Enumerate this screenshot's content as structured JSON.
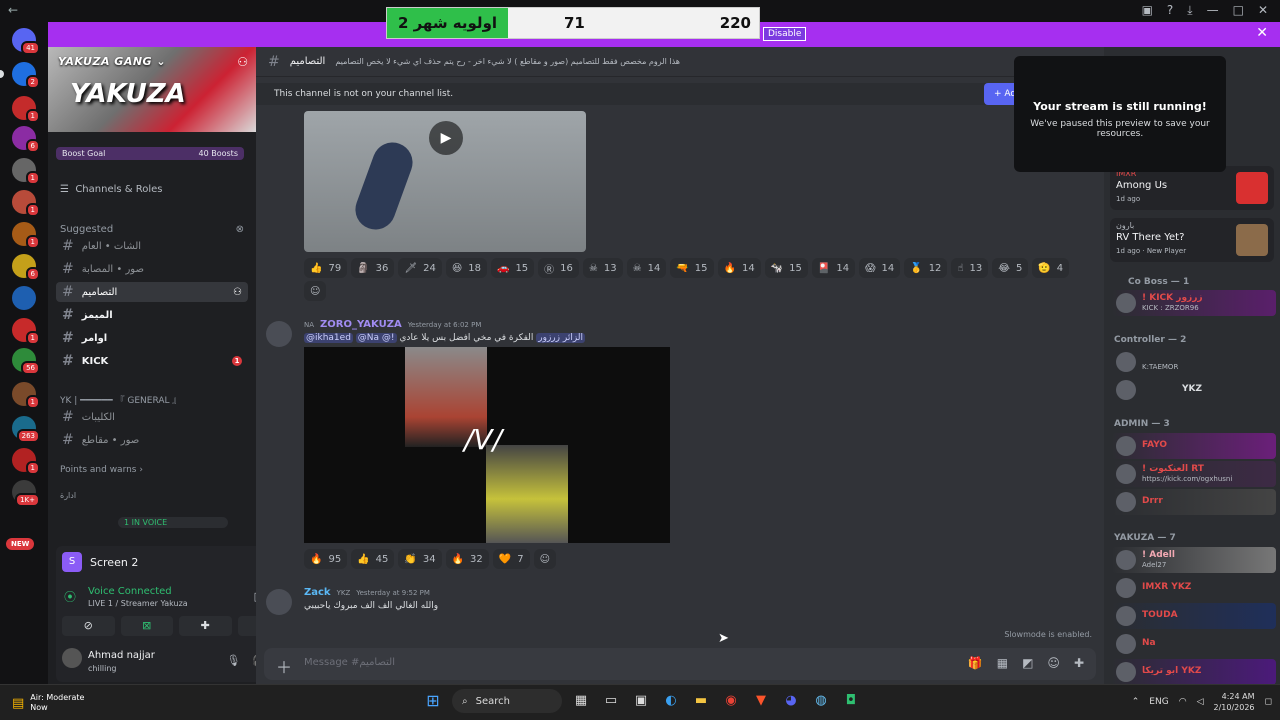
{
  "counter": {
    "title": "اولويه شهر 2",
    "middle": "71",
    "right": "220",
    "disable_label": "Disable"
  },
  "server": {
    "name": "YAKUZA GANG",
    "logo_text": "YAKUZA",
    "boost_goal": "Boost Goal",
    "boost_count": "40 Boosts"
  },
  "rail": {
    "new_label": "NEW",
    "badges": [
      "41",
      "2",
      "1",
      "6",
      "1",
      "1",
      "1",
      "6",
      "1",
      "1",
      "1",
      "56",
      "1",
      "263",
      "1",
      "1K+",
      "1"
    ]
  },
  "sidebar": {
    "channels_roles": "Channels & Roles",
    "suggested_label": "Suggested",
    "suggested": [
      {
        "name": "الشات • العام",
        "active": false,
        "bright": false
      },
      {
        "name": "صور • المصابة",
        "active": false,
        "bright": false
      },
      {
        "name": "التصاميم",
        "active": true,
        "bright": false
      },
      {
        "name": "الميمز",
        "active": false,
        "bright": true
      },
      {
        "name": "اوامر",
        "active": false,
        "bright": true
      },
      {
        "name": "KICK",
        "active": false,
        "bright": true,
        "badge": "1"
      }
    ],
    "general_header": "YK | ━━━━━━ 『 GENERAL 』",
    "general": [
      {
        "name": "الكليبات"
      },
      {
        "name": "صور • مقاطع"
      }
    ],
    "points_warns": "Points and warns",
    "admin_header": "ادارة",
    "in_voice": "1 IN VOICE"
  },
  "voice": {
    "screen_title": "Screen 2",
    "connected": "Voice Connected",
    "live_label": "LIVE 1 / Streamer Yakuza"
  },
  "user": {
    "name": "Ahmad najjar",
    "status": "chilling"
  },
  "channel": {
    "name": "التصاميم",
    "topic": "هذا الروم مخصص فقط للتصاميم (صور و مقاطع ) لا شيء اخر - رح يتم حذف اي شيء لا يخص التصاميم",
    "notice": "This channel is not on your channel list.",
    "notice_button": "+ Add"
  },
  "stream_popup": {
    "title": "Your stream is still running!",
    "subtitle": "We've paused this preview to save your resources."
  },
  "reactions1": [
    {
      "e": "👍",
      "n": "79"
    },
    {
      "e": "🗿",
      "n": "36"
    },
    {
      "e": "🗡",
      "n": "24"
    },
    {
      "e": "😆",
      "n": "18"
    },
    {
      "e": "🚗",
      "n": "15"
    },
    {
      "e": "Ⓡ",
      "n": "16"
    },
    {
      "e": "☠",
      "n": "13"
    },
    {
      "e": "☠",
      "n": "14"
    },
    {
      "e": "🔫",
      "n": "15"
    },
    {
      "e": "🔥",
      "n": "14"
    },
    {
      "e": "🐄",
      "n": "15"
    },
    {
      "e": "🎴",
      "n": "14"
    },
    {
      "e": "😱",
      "n": "14"
    },
    {
      "e": "🥇",
      "n": "12"
    },
    {
      "e": "☝",
      "n": "13"
    },
    {
      "e": "😂",
      "n": "5"
    },
    {
      "e": "🫡",
      "n": "4"
    }
  ],
  "messages": [
    {
      "author": "ZORO_YAKUZA",
      "tag": "NA",
      "time": "Yesterday at 6:02 PM",
      "mentions": [
        "@ikha1ed",
        "@Na @!"
      ],
      "mention_extra": "الزائر زرزور",
      "text": "الفكرة في مخي افضل بس يلا عادي"
    },
    {
      "author": "Zack",
      "tag": "YKZ",
      "time": "Yesterday at 9:52 PM",
      "text": "والله الغالي الف الف مبروك ياحبيبي"
    }
  ],
  "reactions2": [
    {
      "e": "🔥",
      "n": "95"
    },
    {
      "e": "👍",
      "n": "45"
    },
    {
      "e": "👏",
      "n": "34"
    },
    {
      "e": "🔥",
      "n": "32"
    },
    {
      "e": "🧡",
      "n": "7"
    }
  ],
  "composer": {
    "placeholder": "Message #التصاميم",
    "slowmode": "Slowmode is enabled."
  },
  "members": {
    "activities": [
      {
        "user": "IMXR",
        "title": "Among Us",
        "sub": "1d ago"
      },
      {
        "user": "بارون",
        "title": "RV There Yet?",
        "sub": "1d ago · New Player"
      }
    ],
    "categories": [
      {
        "label": "Co Boss — 1",
        "rows": [
          {
            "name": "! KICK زرزور",
            "sub": "KICK : ZRZOR96",
            "color": "#e24a4a"
          }
        ]
      },
      {
        "label": "Controller — 2",
        "rows": [
          {
            "name": "",
            "sub": "K:TAEMOR",
            "color": "#dbdee1"
          },
          {
            "name": "YKZ",
            "sub": "",
            "color": "#dbdee1"
          }
        ]
      },
      {
        "label": "ADMIN — 3",
        "rows": [
          {
            "name": "FAYO",
            "sub": "",
            "color": "#e24a4a"
          },
          {
            "name": "! العنكبوت RT",
            "sub": "https://kick.com/ogxhusni",
            "color": "#e24a4a"
          },
          {
            "name": "Drrr",
            "sub": "",
            "color": "#e24a4a"
          }
        ]
      },
      {
        "label": "YAKUZA — 7",
        "rows": [
          {
            "name": "! Adell",
            "sub": "Adel27",
            "color": "#f2a9b3"
          },
          {
            "name": "IMXR YKZ",
            "sub": "",
            "color": "#e24a4a"
          },
          {
            "name": "TOUDA",
            "sub": "",
            "color": "#e24a4a"
          },
          {
            "name": "Na",
            "sub": "",
            "color": "#e24a4a"
          },
          {
            "name": "ابو تريكا YKZ",
            "sub": "",
            "color": "#e24a4a"
          }
        ]
      }
    ]
  },
  "taskbar": {
    "weather_title": "Air: Moderate",
    "weather_sub": "Now",
    "search": "Search",
    "lang": "ENG",
    "time": "4:24 AM",
    "date": "2/10/2026"
  }
}
